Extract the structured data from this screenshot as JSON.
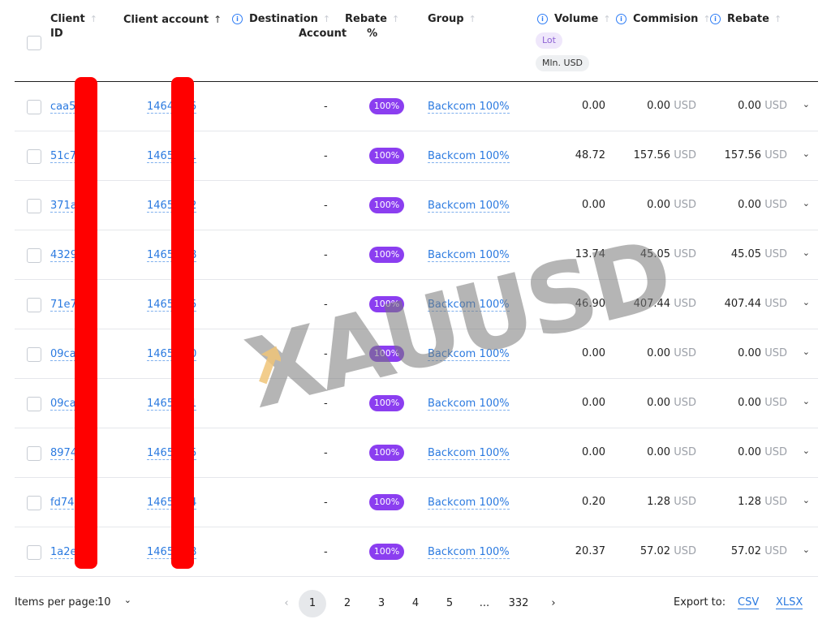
{
  "columns": {
    "client_id": [
      "Client",
      "ID"
    ],
    "client_account": "Client account",
    "destination": [
      "Destination",
      "Account"
    ],
    "rebate_pct": [
      "Rebate",
      "%"
    ],
    "group": "Group",
    "volume": "Volume",
    "commision": "Commision",
    "rebate": "Rebate",
    "volume_unit_lot": "Lot",
    "volume_unit_usd": "Mln. USD",
    "sort_arrow": "↑",
    "info_glyph": "i",
    "chevron": "⌄"
  },
  "rows": [
    {
      "client_id": "caa5",
      "account": "1464",
      "account_tail": "5",
      "destination": "-",
      "rebate_pct": "100%",
      "group": "Backcom 100%",
      "volume": "0.00",
      "commission": "0.00",
      "rebate": "0.00",
      "currency": "USD"
    },
    {
      "client_id": "51c7",
      "account": "1465",
      "account_tail": "1",
      "destination": "-",
      "rebate_pct": "100%",
      "group": "Backcom 100%",
      "volume": "48.72",
      "commission": "157.56",
      "rebate": "157.56",
      "currency": "USD"
    },
    {
      "client_id": "371a",
      "account": "1465",
      "account_tail": "2",
      "destination": "-",
      "rebate_pct": "100%",
      "group": "Backcom 100%",
      "volume": "0.00",
      "commission": "0.00",
      "rebate": "0.00",
      "currency": "USD"
    },
    {
      "client_id": "4329",
      "account": "1465",
      "account_tail": "8",
      "destination": "-",
      "rebate_pct": "100%",
      "group": "Backcom 100%",
      "volume": "13.74",
      "commission": "45.05",
      "rebate": "45.05",
      "currency": "USD"
    },
    {
      "client_id": "71e7",
      "account": "1465",
      "account_tail": "5",
      "destination": "-",
      "rebate_pct": "100%",
      "group": "Backcom 100%",
      "volume": "46.90",
      "commission": "407.44",
      "rebate": "407.44",
      "currency": "USD"
    },
    {
      "client_id": "09ca",
      "account": "1465",
      "account_tail": "0",
      "destination": "-",
      "rebate_pct": "100%",
      "group": "Backcom 100%",
      "volume": "0.00",
      "commission": "0.00",
      "rebate": "0.00",
      "currency": "USD"
    },
    {
      "client_id": "09ca",
      "account": "1465",
      "account_tail": "1",
      "destination": "-",
      "rebate_pct": "100%",
      "group": "Backcom 100%",
      "volume": "0.00",
      "commission": "0.00",
      "rebate": "0.00",
      "currency": "USD"
    },
    {
      "client_id": "8974",
      "account": "1465",
      "account_tail": "5",
      "destination": "-",
      "rebate_pct": "100%",
      "group": "Backcom 100%",
      "volume": "0.00",
      "commission": "0.00",
      "rebate": "0.00",
      "currency": "USD"
    },
    {
      "client_id": "fd74",
      "account": "1465",
      "account_tail": "4",
      "destination": "-",
      "rebate_pct": "100%",
      "group": "Backcom 100%",
      "volume": "0.20",
      "commission": "1.28",
      "rebate": "1.28",
      "currency": "USD"
    },
    {
      "client_id": "1a2e",
      "account": "1465",
      "account_tail": "8",
      "destination": "-",
      "rebate_pct": "100%",
      "group": "Backcom 100%",
      "volume": "20.37",
      "commission": "57.02",
      "rebate": "57.02",
      "currency": "USD"
    }
  ],
  "pagination": {
    "items_per_page_label": "Items per page:",
    "items_per_page": "10",
    "prev": "‹",
    "next": "›",
    "pages": [
      "1",
      "2",
      "3",
      "4",
      "5",
      "...",
      "332"
    ],
    "current": "1"
  },
  "export": {
    "label": "Export to:",
    "csv": "CSV",
    "xlsx": "XLSX"
  },
  "watermark": "XAUUSD",
  "colors": {
    "accent": "#2b7ae0",
    "badge": "#8b3ef0",
    "redaction": "#ff0000"
  }
}
